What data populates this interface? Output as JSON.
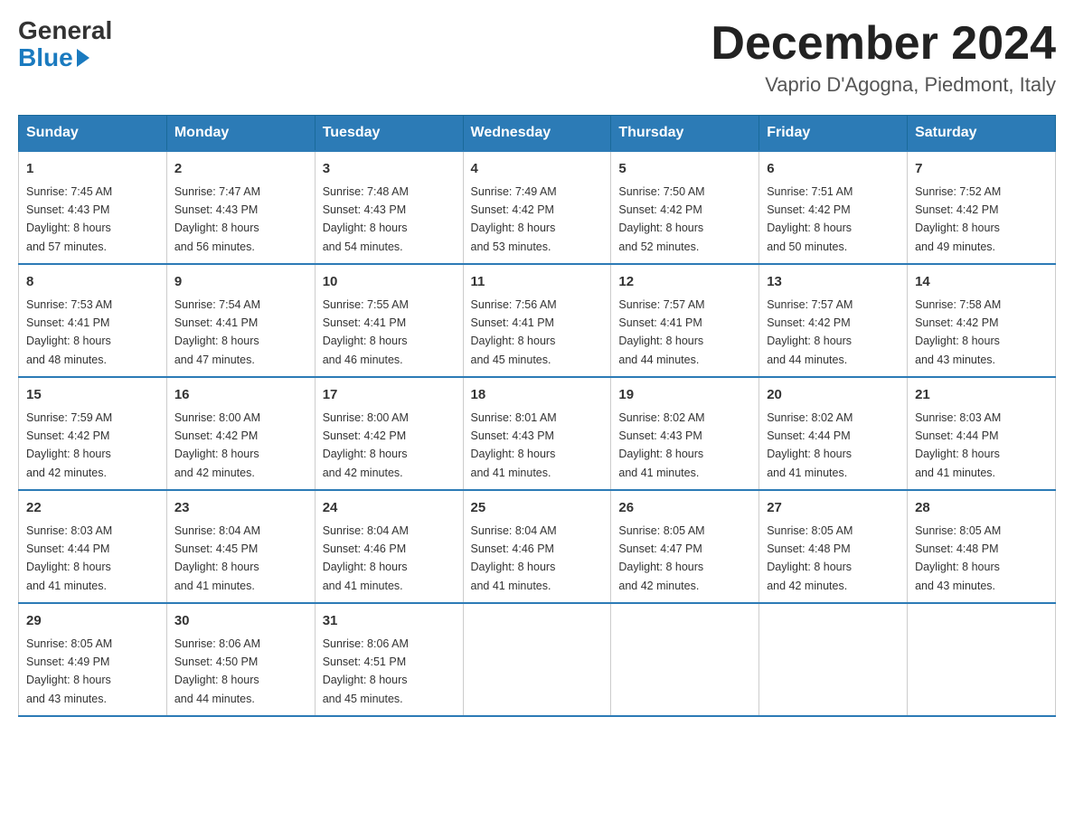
{
  "logo": {
    "general": "General",
    "blue": "Blue"
  },
  "header": {
    "month_year": "December 2024",
    "location": "Vaprio D'Agogna, Piedmont, Italy"
  },
  "days_of_week": [
    "Sunday",
    "Monday",
    "Tuesday",
    "Wednesday",
    "Thursday",
    "Friday",
    "Saturday"
  ],
  "weeks": [
    [
      {
        "day": "1",
        "sunrise": "7:45 AM",
        "sunset": "4:43 PM",
        "daylight": "8 hours and 57 minutes."
      },
      {
        "day": "2",
        "sunrise": "7:47 AM",
        "sunset": "4:43 PM",
        "daylight": "8 hours and 56 minutes."
      },
      {
        "day": "3",
        "sunrise": "7:48 AM",
        "sunset": "4:43 PM",
        "daylight": "8 hours and 54 minutes."
      },
      {
        "day": "4",
        "sunrise": "7:49 AM",
        "sunset": "4:42 PM",
        "daylight": "8 hours and 53 minutes."
      },
      {
        "day": "5",
        "sunrise": "7:50 AM",
        "sunset": "4:42 PM",
        "daylight": "8 hours and 52 minutes."
      },
      {
        "day": "6",
        "sunrise": "7:51 AM",
        "sunset": "4:42 PM",
        "daylight": "8 hours and 50 minutes."
      },
      {
        "day": "7",
        "sunrise": "7:52 AM",
        "sunset": "4:42 PM",
        "daylight": "8 hours and 49 minutes."
      }
    ],
    [
      {
        "day": "8",
        "sunrise": "7:53 AM",
        "sunset": "4:41 PM",
        "daylight": "8 hours and 48 minutes."
      },
      {
        "day": "9",
        "sunrise": "7:54 AM",
        "sunset": "4:41 PM",
        "daylight": "8 hours and 47 minutes."
      },
      {
        "day": "10",
        "sunrise": "7:55 AM",
        "sunset": "4:41 PM",
        "daylight": "8 hours and 46 minutes."
      },
      {
        "day": "11",
        "sunrise": "7:56 AM",
        "sunset": "4:41 PM",
        "daylight": "8 hours and 45 minutes."
      },
      {
        "day": "12",
        "sunrise": "7:57 AM",
        "sunset": "4:41 PM",
        "daylight": "8 hours and 44 minutes."
      },
      {
        "day": "13",
        "sunrise": "7:57 AM",
        "sunset": "4:42 PM",
        "daylight": "8 hours and 44 minutes."
      },
      {
        "day": "14",
        "sunrise": "7:58 AM",
        "sunset": "4:42 PM",
        "daylight": "8 hours and 43 minutes."
      }
    ],
    [
      {
        "day": "15",
        "sunrise": "7:59 AM",
        "sunset": "4:42 PM",
        "daylight": "8 hours and 42 minutes."
      },
      {
        "day": "16",
        "sunrise": "8:00 AM",
        "sunset": "4:42 PM",
        "daylight": "8 hours and 42 minutes."
      },
      {
        "day": "17",
        "sunrise": "8:00 AM",
        "sunset": "4:42 PM",
        "daylight": "8 hours and 42 minutes."
      },
      {
        "day": "18",
        "sunrise": "8:01 AM",
        "sunset": "4:43 PM",
        "daylight": "8 hours and 41 minutes."
      },
      {
        "day": "19",
        "sunrise": "8:02 AM",
        "sunset": "4:43 PM",
        "daylight": "8 hours and 41 minutes."
      },
      {
        "day": "20",
        "sunrise": "8:02 AM",
        "sunset": "4:44 PM",
        "daylight": "8 hours and 41 minutes."
      },
      {
        "day": "21",
        "sunrise": "8:03 AM",
        "sunset": "4:44 PM",
        "daylight": "8 hours and 41 minutes."
      }
    ],
    [
      {
        "day": "22",
        "sunrise": "8:03 AM",
        "sunset": "4:44 PM",
        "daylight": "8 hours and 41 minutes."
      },
      {
        "day": "23",
        "sunrise": "8:04 AM",
        "sunset": "4:45 PM",
        "daylight": "8 hours and 41 minutes."
      },
      {
        "day": "24",
        "sunrise": "8:04 AM",
        "sunset": "4:46 PM",
        "daylight": "8 hours and 41 minutes."
      },
      {
        "day": "25",
        "sunrise": "8:04 AM",
        "sunset": "4:46 PM",
        "daylight": "8 hours and 41 minutes."
      },
      {
        "day": "26",
        "sunrise": "8:05 AM",
        "sunset": "4:47 PM",
        "daylight": "8 hours and 42 minutes."
      },
      {
        "day": "27",
        "sunrise": "8:05 AM",
        "sunset": "4:48 PM",
        "daylight": "8 hours and 42 minutes."
      },
      {
        "day": "28",
        "sunrise": "8:05 AM",
        "sunset": "4:48 PM",
        "daylight": "8 hours and 43 minutes."
      }
    ],
    [
      {
        "day": "29",
        "sunrise": "8:05 AM",
        "sunset": "4:49 PM",
        "daylight": "8 hours and 43 minutes."
      },
      {
        "day": "30",
        "sunrise": "8:06 AM",
        "sunset": "4:50 PM",
        "daylight": "8 hours and 44 minutes."
      },
      {
        "day": "31",
        "sunrise": "8:06 AM",
        "sunset": "4:51 PM",
        "daylight": "8 hours and 45 minutes."
      },
      null,
      null,
      null,
      null
    ]
  ],
  "labels": {
    "sunrise": "Sunrise:",
    "sunset": "Sunset:",
    "daylight": "Daylight:"
  }
}
